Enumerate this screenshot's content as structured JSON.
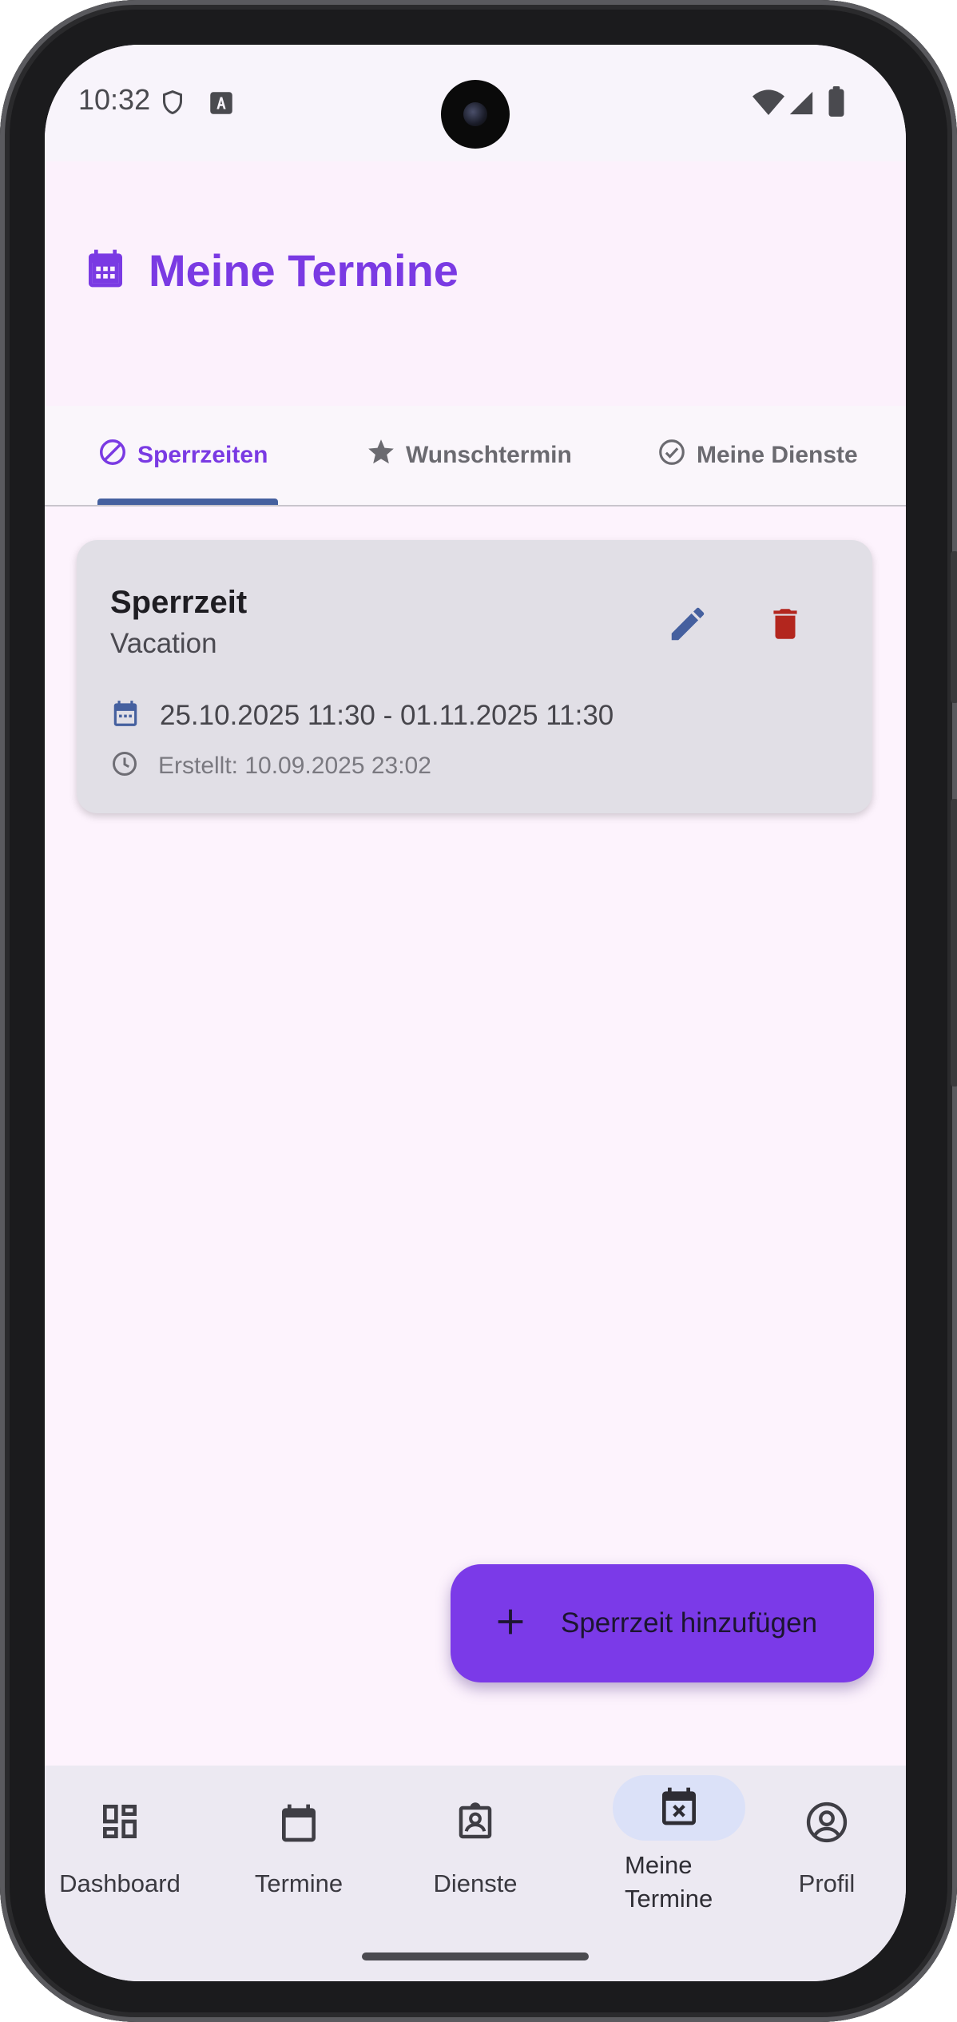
{
  "status_bar": {
    "time": "10:32",
    "icons": [
      "shield-icon",
      "font-a-icon",
      "wifi-icon",
      "signal-icon",
      "battery-icon"
    ]
  },
  "header": {
    "icon": "calendar-icon",
    "title": "Meine Termine"
  },
  "tabs": [
    {
      "label": "Sperrzeiten",
      "icon": "block-icon",
      "active": true
    },
    {
      "label": "Wunschtermin",
      "icon": "star-icon",
      "active": false
    },
    {
      "label": "Meine Dienste",
      "icon": "check-circle-icon",
      "active": false
    }
  ],
  "card": {
    "title": "Sperrzeit",
    "subtitle": "Vacation",
    "date_range": "25.10.2025 11:30 - 01.11.2025 11:30",
    "created": "Erstellt: 10.09.2025 23:02"
  },
  "fab": {
    "label": "Sperrzeit hinzufügen"
  },
  "bottom_nav": [
    {
      "label": "Dashboard",
      "icon": "dashboard-icon"
    },
    {
      "label": "Termine",
      "icon": "calendar-blank-icon"
    },
    {
      "label": "Dienste",
      "icon": "badge-icon"
    },
    {
      "label_line1": "Meine",
      "label_line2": "Termine",
      "icon": "calendar-x-icon",
      "active": true
    },
    {
      "label": "Profil",
      "icon": "account-circle-icon"
    }
  ],
  "colors": {
    "accent": "#7a3ae3",
    "indicator": "#45609f",
    "edit": "#45609f",
    "delete": "#b3261e",
    "fab": "#7b3ae8",
    "screen_bg": "#fdf3fd"
  }
}
